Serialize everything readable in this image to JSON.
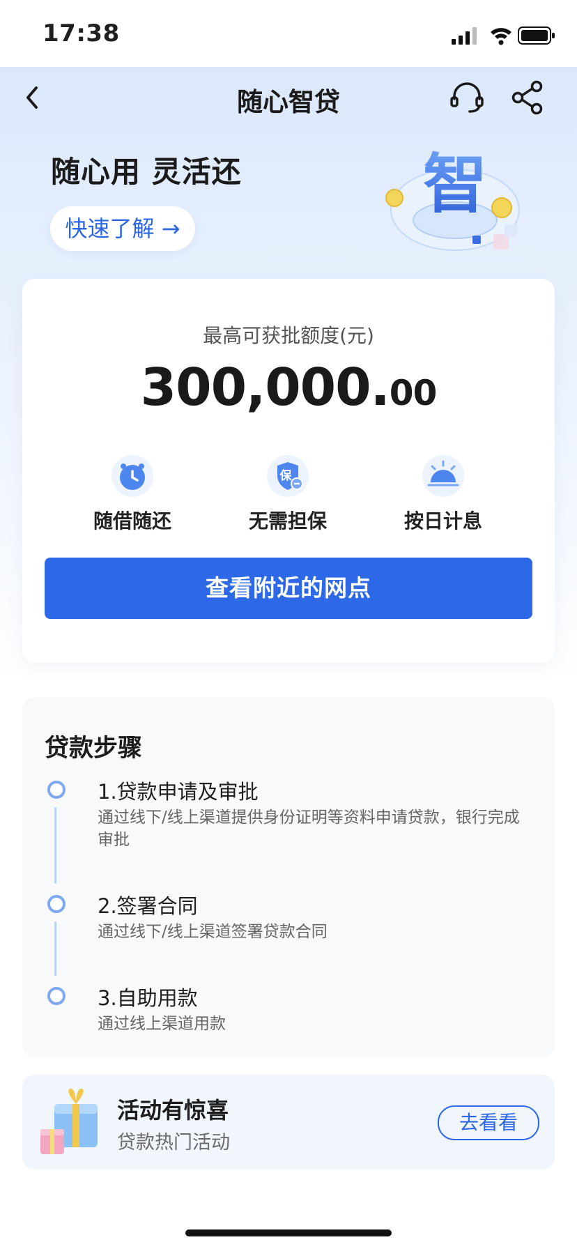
{
  "status_bar": {
    "time": "17:38"
  },
  "nav": {
    "title": "随心智贷",
    "icons": [
      "back-icon",
      "headset-icon",
      "share-icon"
    ]
  },
  "hero": {
    "slogan": "随心用 灵活还",
    "learn_more": "快速了解 →",
    "art_glyph": "智"
  },
  "quota": {
    "label": "最高可获批额度(元)",
    "amount_main": "300,000.",
    "amount_decimal": "00"
  },
  "features": [
    {
      "label": "随借随还",
      "icon": "clock-icon"
    },
    {
      "label": "无需担保",
      "icon": "shield-icon",
      "icon_text": "保"
    },
    {
      "label": "按日计息",
      "icon": "sunrise-icon"
    }
  ],
  "nearby_button": "查看附近的网点",
  "steps": {
    "title": "贷款步骤",
    "items": [
      {
        "title": "1.贷款申请及审批",
        "desc": "通过线下/线上渠道提供身份证明等资料申请贷款，银行完成审批"
      },
      {
        "title": "2.签署合同",
        "desc": "通过线下/线上渠道签署贷款合同"
      },
      {
        "title": "3.自助用款",
        "desc": "通过线上渠道用款"
      }
    ]
  },
  "promo": {
    "title": "活动有惊喜",
    "subtitle": "贷款热门活动",
    "button": "去看看",
    "icon": "gift-icon"
  },
  "colors": {
    "primary": "#2d68e6",
    "hero_bg": "#dbe8fb",
    "card_bg": "#ffffff",
    "steps_bg": "#f8f9fb",
    "promo_bg": "#f1f5fc"
  }
}
